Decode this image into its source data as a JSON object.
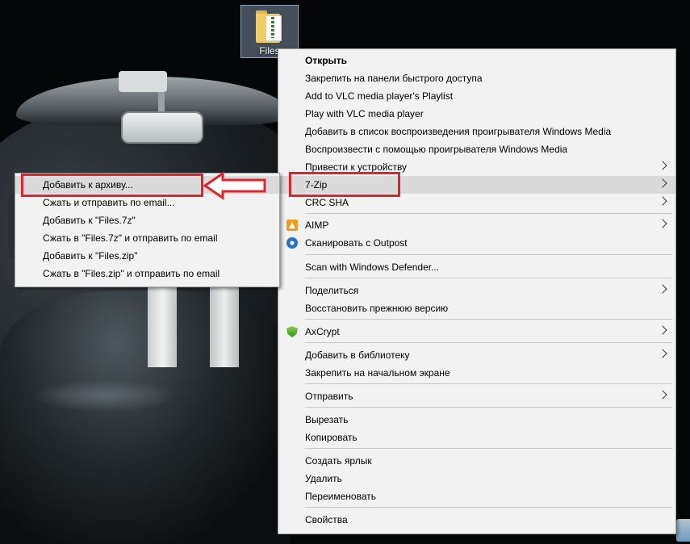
{
  "desktop": {
    "icon_label": "Files"
  },
  "context_menu": {
    "items": [
      {
        "label": "Открыть",
        "bold": true
      },
      {
        "label": "Закрепить на панели быстрого доступа"
      },
      {
        "label": "Add to VLC media player's Playlist"
      },
      {
        "label": "Play with VLC media player"
      },
      {
        "label": "Добавить в список воспроизведения проигрывателя Windows Media"
      },
      {
        "label": "Воспроизвести с помощью проигрывателя Windows Media"
      },
      {
        "label": "Привести к устройству",
        "submenu": true
      },
      {
        "label": "7-Zip",
        "submenu": true,
        "highlighted": true
      },
      {
        "label": "CRC SHA",
        "submenu": true
      },
      {
        "label": "AIMP",
        "submenu": true,
        "icon": "aimp-icon"
      },
      {
        "label": "Сканировать с Outpost",
        "icon": "outpost-icon"
      },
      {
        "label": "Scan with Windows Defender..."
      },
      {
        "label": "Поделиться",
        "submenu": true
      },
      {
        "label": "Восстановить прежнюю версию"
      },
      {
        "label": "AxCrypt",
        "submenu": true,
        "icon": "axcrypt-icon"
      },
      {
        "label": "Добавить в библиотеку",
        "submenu": true
      },
      {
        "label": "Закрепить на начальном экране"
      },
      {
        "label": "Отправить",
        "submenu": true
      },
      {
        "label": "Вырезать"
      },
      {
        "label": "Копировать"
      },
      {
        "label": "Создать ярлык"
      },
      {
        "label": "Удалить"
      },
      {
        "label": "Переименовать"
      },
      {
        "label": "Свойства"
      }
    ]
  },
  "zip_submenu": {
    "items": [
      {
        "label": "Добавить к архиву..."
      },
      {
        "label": "Сжать и отправить по email..."
      },
      {
        "label": "Добавить к \"Files.7z\""
      },
      {
        "label": "Сжать в \"Files.7z\" и отправить по email"
      },
      {
        "label": "Добавить к \"Files.zip\""
      },
      {
        "label": "Сжать в \"Files.zip\" и отправить по email"
      }
    ]
  },
  "annotation_color": "#e0242c",
  "menu_background": "#f2f2f2"
}
